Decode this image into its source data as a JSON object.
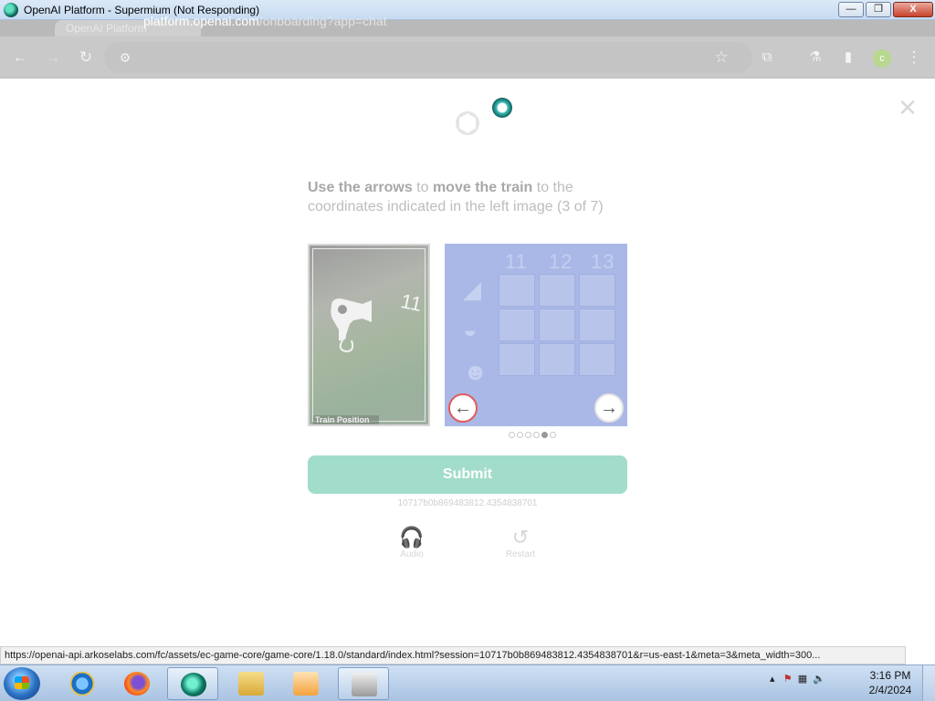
{
  "window": {
    "title": "OpenAI Platform - Supermium (Not Responding)",
    "minimize_label": "—",
    "restore_label": "❐",
    "close_label": "X"
  },
  "browser": {
    "tab_title": "OpenAI Platform",
    "url_host": "platform.openai.com",
    "url_path": "/onboarding?app=chat",
    "profile_initial": "c"
  },
  "challenge": {
    "instruction_bold1": "Use the arrows",
    "instruction_mid1": " to ",
    "instruction_bold2": "move the train",
    "instruction_rest": " to the coordinates indicated in the left image (3 of 7)",
    "target_label": "Train Position",
    "target_number": "11",
    "coordinates": [
      "11",
      "12",
      "13"
    ],
    "page_dots": 6,
    "active_dot": 4,
    "submit_label": "Submit",
    "session_id": "10717b0b869483812.4354838701",
    "audio_label": "Audio",
    "restart_label": "Restart"
  },
  "statusbar": {
    "url": "https://openai-api.arkoselabs.com/fc/assets/ec-game-core/game-core/1.18.0/standard/index.html?session=10717b0b869483812.4354838701&r=us-east-1&meta=3&meta_width=300..."
  },
  "taskbar": {
    "apps": [
      "start-button",
      "internet-explorer",
      "firefox",
      "supermium",
      "file-explorer",
      "media-player",
      "printer-fax"
    ],
    "time": "3:16 PM",
    "date": "2/4/2024"
  },
  "colors": {
    "submit_bg": "#a2dcca",
    "game_bg": "#a9b8e6",
    "accent_red": "#e05b5b"
  }
}
